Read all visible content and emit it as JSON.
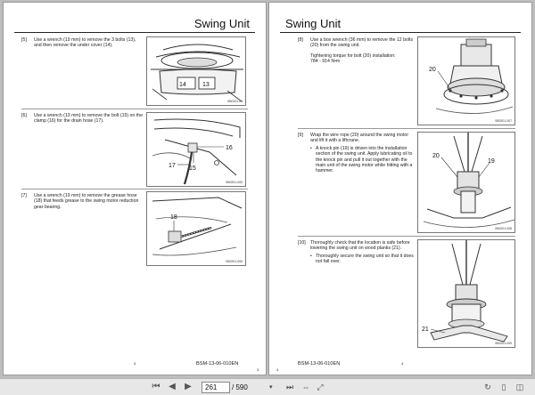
{
  "left_page": {
    "header": "Swing Unit",
    "steps": [
      {
        "num": "[5]",
        "text": "Use a wrench (19 mm) to remove the 3 bolts (13), and then remove the under cover (14).",
        "figure": {
          "code": "SB0201-04",
          "callouts": [
            "14",
            "13"
          ]
        }
      },
      {
        "num": "[6]",
        "text": "Use a wrench (13 mm) to remove the bolt (15) on the clamp (16) for the drain hose (17).",
        "figure": {
          "code": "SB0201-005",
          "callouts": [
            "16",
            "17",
            "15"
          ]
        }
      },
      {
        "num": "[7]",
        "text": "Use a wrench (19 mm) to remove the grease hose (18) that feeds grease to the swing motor reduction gear bearing.",
        "figure": {
          "code": "SB0201-006",
          "callouts": [
            "18"
          ]
        }
      }
    ],
    "page_number": "3",
    "doc_code": "BSM-13-06-010EN",
    "corner_number": "3"
  },
  "right_page": {
    "header": "Swing Unit",
    "steps": [
      {
        "num": "[8]",
        "text": "Use a box wrench (36 mm) to remove the 12 bolts (20) from the swing unit.",
        "sub": "Tightening torque for bolt (20) installation:",
        "torque": "784 - 914 N•m",
        "figure": {
          "code": "SB0201-007",
          "callouts": [
            "20"
          ]
        }
      },
      {
        "num": "[9]",
        "text": "Wrap the wire rope (20) around the swing motor and lift it with a liftcrane.",
        "bullets": [
          "A knock pin (19) is driven into the installation section of the swing unit. Apply lubricating oil to the knock pin and pull it out together with the main unit of the swing motor while hitting with a hammer."
        ],
        "figure": {
          "code": "SB0201-008",
          "callouts": [
            "20",
            "19"
          ]
        }
      },
      {
        "num": "[10]",
        "text": "Thoroughly check that the location is safe before lowering the swing unit on wood planks (21).",
        "bullets": [
          "Thoroughly secure the swing unit so that it does not fall over."
        ],
        "figure": {
          "code": "SB0201-009",
          "callouts": [
            "21"
          ]
        }
      }
    ],
    "doc_code": "BSM-13-06-010EN",
    "page_number": "4",
    "corner_number": "4"
  },
  "toolbar": {
    "current_page": "261",
    "total_pages": "/ 590",
    "icons": [
      "first-page-icon",
      "prev-page-icon",
      "next-page-icon",
      "last-page-icon",
      "zoom-dropdown-icon",
      "fit-width-icon",
      "fit-page-icon",
      "rotate-icon",
      "single-page-icon",
      "two-page-icon"
    ]
  }
}
